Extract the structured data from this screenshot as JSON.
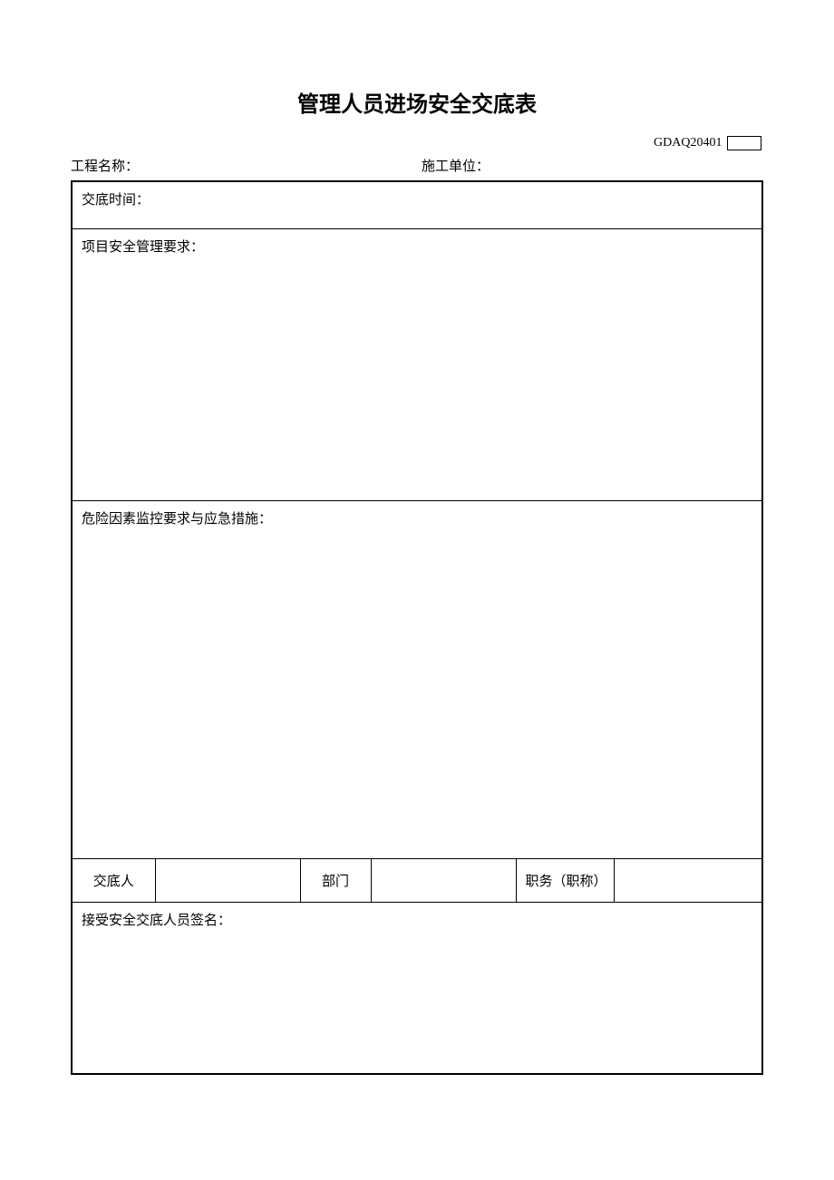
{
  "title": "管理人员进场安全交底表",
  "formCode": "GDAQ20401",
  "headerLabels": {
    "projectName": "工程名称：",
    "constructionUnit": "施工单位："
  },
  "rows": {
    "timeLabel": "交底时间：",
    "requirementsLabel": "项目安全管理要求：",
    "riskLabel": "危险因素监控要求与应急措施：",
    "signaturesLabel": "接受安全交底人员签名："
  },
  "signerRow": {
    "personLabel": "交底人",
    "personValue": "",
    "deptLabel": "部门",
    "deptValue": "",
    "positionLabel": "职务（职称）",
    "positionValue": ""
  }
}
